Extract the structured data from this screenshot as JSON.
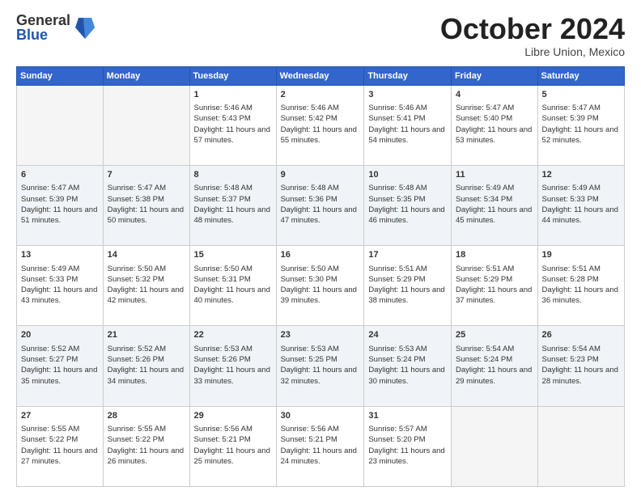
{
  "logo": {
    "general": "General",
    "blue": "Blue"
  },
  "title": "October 2024",
  "subtitle": "Libre Union, Mexico",
  "days": [
    "Sunday",
    "Monday",
    "Tuesday",
    "Wednesday",
    "Thursday",
    "Friday",
    "Saturday"
  ],
  "weeks": [
    [
      {
        "day": "",
        "info": ""
      },
      {
        "day": "",
        "info": ""
      },
      {
        "day": "1",
        "info": "Sunrise: 5:46 AM\nSunset: 5:43 PM\nDaylight: 11 hours and 57 minutes."
      },
      {
        "day": "2",
        "info": "Sunrise: 5:46 AM\nSunset: 5:42 PM\nDaylight: 11 hours and 55 minutes."
      },
      {
        "day": "3",
        "info": "Sunrise: 5:46 AM\nSunset: 5:41 PM\nDaylight: 11 hours and 54 minutes."
      },
      {
        "day": "4",
        "info": "Sunrise: 5:47 AM\nSunset: 5:40 PM\nDaylight: 11 hours and 53 minutes."
      },
      {
        "day": "5",
        "info": "Sunrise: 5:47 AM\nSunset: 5:39 PM\nDaylight: 11 hours and 52 minutes."
      }
    ],
    [
      {
        "day": "6",
        "info": "Sunrise: 5:47 AM\nSunset: 5:39 PM\nDaylight: 11 hours and 51 minutes."
      },
      {
        "day": "7",
        "info": "Sunrise: 5:47 AM\nSunset: 5:38 PM\nDaylight: 11 hours and 50 minutes."
      },
      {
        "day": "8",
        "info": "Sunrise: 5:48 AM\nSunset: 5:37 PM\nDaylight: 11 hours and 48 minutes."
      },
      {
        "day": "9",
        "info": "Sunrise: 5:48 AM\nSunset: 5:36 PM\nDaylight: 11 hours and 47 minutes."
      },
      {
        "day": "10",
        "info": "Sunrise: 5:48 AM\nSunset: 5:35 PM\nDaylight: 11 hours and 46 minutes."
      },
      {
        "day": "11",
        "info": "Sunrise: 5:49 AM\nSunset: 5:34 PM\nDaylight: 11 hours and 45 minutes."
      },
      {
        "day": "12",
        "info": "Sunrise: 5:49 AM\nSunset: 5:33 PM\nDaylight: 11 hours and 44 minutes."
      }
    ],
    [
      {
        "day": "13",
        "info": "Sunrise: 5:49 AM\nSunset: 5:33 PM\nDaylight: 11 hours and 43 minutes."
      },
      {
        "day": "14",
        "info": "Sunrise: 5:50 AM\nSunset: 5:32 PM\nDaylight: 11 hours and 42 minutes."
      },
      {
        "day": "15",
        "info": "Sunrise: 5:50 AM\nSunset: 5:31 PM\nDaylight: 11 hours and 40 minutes."
      },
      {
        "day": "16",
        "info": "Sunrise: 5:50 AM\nSunset: 5:30 PM\nDaylight: 11 hours and 39 minutes."
      },
      {
        "day": "17",
        "info": "Sunrise: 5:51 AM\nSunset: 5:29 PM\nDaylight: 11 hours and 38 minutes."
      },
      {
        "day": "18",
        "info": "Sunrise: 5:51 AM\nSunset: 5:29 PM\nDaylight: 11 hours and 37 minutes."
      },
      {
        "day": "19",
        "info": "Sunrise: 5:51 AM\nSunset: 5:28 PM\nDaylight: 11 hours and 36 minutes."
      }
    ],
    [
      {
        "day": "20",
        "info": "Sunrise: 5:52 AM\nSunset: 5:27 PM\nDaylight: 11 hours and 35 minutes."
      },
      {
        "day": "21",
        "info": "Sunrise: 5:52 AM\nSunset: 5:26 PM\nDaylight: 11 hours and 34 minutes."
      },
      {
        "day": "22",
        "info": "Sunrise: 5:53 AM\nSunset: 5:26 PM\nDaylight: 11 hours and 33 minutes."
      },
      {
        "day": "23",
        "info": "Sunrise: 5:53 AM\nSunset: 5:25 PM\nDaylight: 11 hours and 32 minutes."
      },
      {
        "day": "24",
        "info": "Sunrise: 5:53 AM\nSunset: 5:24 PM\nDaylight: 11 hours and 30 minutes."
      },
      {
        "day": "25",
        "info": "Sunrise: 5:54 AM\nSunset: 5:24 PM\nDaylight: 11 hours and 29 minutes."
      },
      {
        "day": "26",
        "info": "Sunrise: 5:54 AM\nSunset: 5:23 PM\nDaylight: 11 hours and 28 minutes."
      }
    ],
    [
      {
        "day": "27",
        "info": "Sunrise: 5:55 AM\nSunset: 5:22 PM\nDaylight: 11 hours and 27 minutes."
      },
      {
        "day": "28",
        "info": "Sunrise: 5:55 AM\nSunset: 5:22 PM\nDaylight: 11 hours and 26 minutes."
      },
      {
        "day": "29",
        "info": "Sunrise: 5:56 AM\nSunset: 5:21 PM\nDaylight: 11 hours and 25 minutes."
      },
      {
        "day": "30",
        "info": "Sunrise: 5:56 AM\nSunset: 5:21 PM\nDaylight: 11 hours and 24 minutes."
      },
      {
        "day": "31",
        "info": "Sunrise: 5:57 AM\nSunset: 5:20 PM\nDaylight: 11 hours and 23 minutes."
      },
      {
        "day": "",
        "info": ""
      },
      {
        "day": "",
        "info": ""
      }
    ]
  ]
}
